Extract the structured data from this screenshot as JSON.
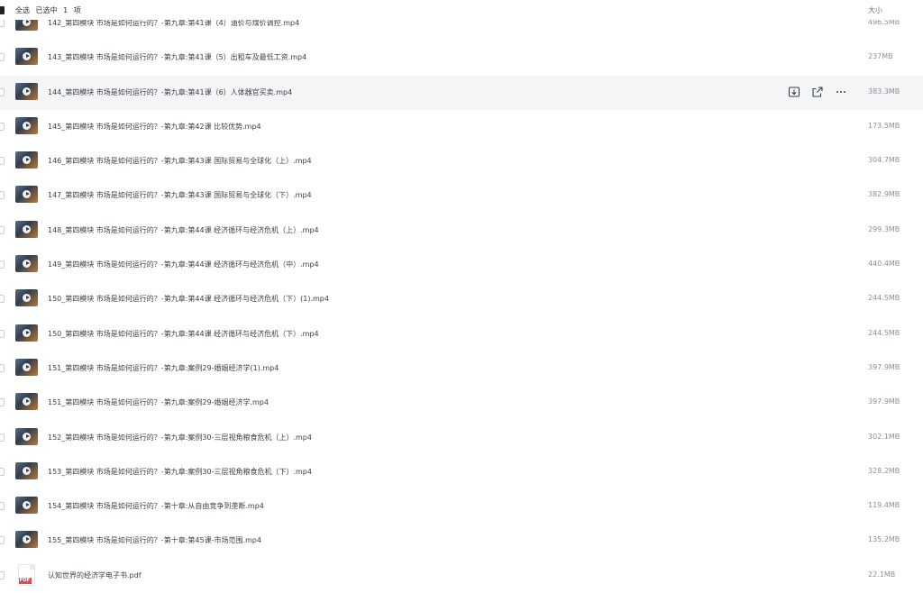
{
  "header": {
    "select_all": "全选",
    "selected_label": "已选中",
    "selected_count": "1",
    "selected_unit": "项",
    "size_column": "大小"
  },
  "row_actions": {
    "icons": [
      "download-icon",
      "share-icon",
      "more-icon"
    ]
  },
  "files": [
    {
      "name": "142_第四模块 市场是如何运行的？-第九章:第41课（4）油价与煤价调控.mp4",
      "size": "496.5MB",
      "type": "video"
    },
    {
      "name": "143_第四模块 市场是如何运行的？-第九章:第41课（5）出租车及最低工资.mp4",
      "size": "237MB",
      "type": "video"
    },
    {
      "name": "144_第四模块 市场是如何运行的？-第九章:第41课（6）人体器官买卖.mp4",
      "size": "383.3MB",
      "type": "video"
    },
    {
      "name": "145_第四模块 市场是如何运行的？-第九章:第42课 比较优势.mp4",
      "size": "173.5MB",
      "type": "video"
    },
    {
      "name": "146_第四模块 市场是如何运行的？-第九章:第43课 国际贸易与全球化（上）.mp4",
      "size": "304.7MB",
      "type": "video"
    },
    {
      "name": "147_第四模块 市场是如何运行的？-第九章:第43课 国际贸易与全球化（下）.mp4",
      "size": "382.9MB",
      "type": "video"
    },
    {
      "name": "148_第四模块 市场是如何运行的？-第九章:第44课 经济循环与经济危机（上）.mp4",
      "size": "299.3MB",
      "type": "video"
    },
    {
      "name": "149_第四模块 市场是如何运行的？-第九章:第44课 经济循环与经济危机（中）.mp4",
      "size": "440.4MB",
      "type": "video"
    },
    {
      "name": "150_第四模块 市场是如何运行的？-第九章:第44课 经济循环与经济危机（下）(1).mp4",
      "size": "244.5MB",
      "type": "video"
    },
    {
      "name": "150_第四模块 市场是如何运行的？-第九章:第44课 经济循环与经济危机（下）.mp4",
      "size": "244.5MB",
      "type": "video"
    },
    {
      "name": "151_第四模块 市场是如何运行的？-第九章:案例29-婚姻经济学(1).mp4",
      "size": "397.9MB",
      "type": "video"
    },
    {
      "name": "151_第四模块 市场是如何运行的？-第九章:案例29-婚姻经济学.mp4",
      "size": "397.9MB",
      "type": "video"
    },
    {
      "name": "152_第四模块 市场是如何运行的？-第九章:案例30-三层视角粮食危机（上）.mp4",
      "size": "302.1MB",
      "type": "video"
    },
    {
      "name": "153_第四模块 市场是如何运行的？-第九章:案例30-三层视角粮食危机（下）.mp4",
      "size": "328.2MB",
      "type": "video"
    },
    {
      "name": "154_第四模块 市场是如何运行的？-第十章:从自由竞争到垄断.mp4",
      "size": "119.4MB",
      "type": "video"
    },
    {
      "name": "155_第四模块 市场是如何运行的？-第十章:第45课-市场范围.mp4",
      "size": "135.2MB",
      "type": "video"
    },
    {
      "name": "认知世界的经济学电子书.pdf",
      "size": "22.1MB",
      "type": "pdf",
      "badge": "PDF"
    }
  ]
}
